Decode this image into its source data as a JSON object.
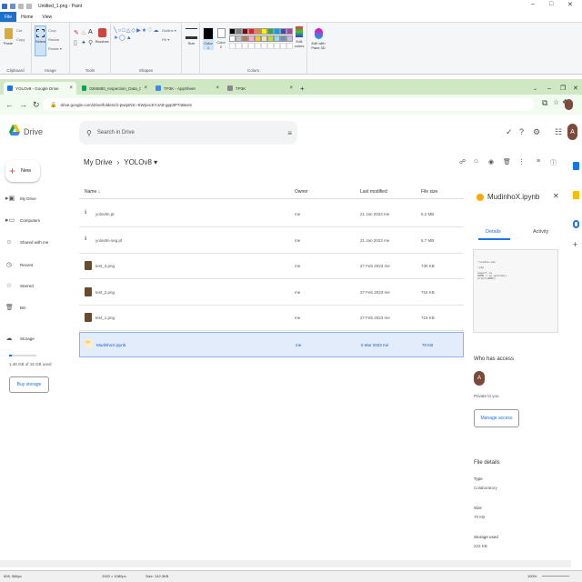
{
  "paint": {
    "title": "Untitled_1.png - Paint",
    "menu": [
      "File",
      "Home",
      "View"
    ],
    "groups": {
      "clipboard": "Clipboard",
      "image": "Image",
      "tools": "Tools",
      "shapes": "Shapes",
      "colors": "Colors"
    },
    "buttons": {
      "paste": "Paste",
      "cut": "Cut",
      "copy": "Copy",
      "select": "Select",
      "crop": "Crop",
      "resize": "Resize",
      "rotate": "Rotate ▾",
      "brushes": "Brushes",
      "outline": "Outline ▾",
      "fill": "Fill ▾",
      "size": "Size",
      "color1": "Color 1",
      "color2": "Color 2",
      "edit_colors": "Edit colors",
      "edit_paint3d": "Edit with Paint 3D"
    },
    "palette": [
      "#000000",
      "#7f7f7f",
      "#880015",
      "#ed1c24",
      "#ff7f27",
      "#fff200",
      "#22b14c",
      "#00a2e8",
      "#3f48cc",
      "#a349a4",
      "#ffffff",
      "#c3c3c3",
      "#b97a57",
      "#ffaec9",
      "#ffc90e",
      "#efe4b0",
      "#b5e61d",
      "#99d9ea",
      "#7092be",
      "#c8bfe7"
    ]
  },
  "browser": {
    "tabs": [
      {
        "label": "YOLOv8 - Google Drive",
        "color": "#1a73e8"
      },
      {
        "label": "0265880_Inspection_Data_07/03",
        "color": "#0f9d58"
      },
      {
        "label": "TP3K - AppSheet",
        "color": "#4285f4"
      },
      {
        "label": "TP3K",
        "color": "#888888"
      }
    ],
    "new_tab": "+",
    "url": "drive.google.com/drive/folders/1-pwqsNS--SWjxocKYJA8-gpp3P7nBeeS"
  },
  "drive": {
    "app": "Drive",
    "search_placeholder": "Search in Drive",
    "new": "New",
    "avatar": "A",
    "nav": [
      {
        "label": "My Drive",
        "icon": "drive"
      },
      {
        "label": "Computers",
        "icon": "computer"
      },
      {
        "label": "Shared with me",
        "icon": "people"
      },
      {
        "label": "Recent",
        "icon": "clock"
      },
      {
        "label": "Starred",
        "icon": "star"
      },
      {
        "label": "Bin",
        "icon": "trash"
      },
      {
        "label": "Storage",
        "icon": "cloud"
      }
    ],
    "storage_used": "1.48 GB of 15 GB used",
    "storage_fraction": 0.099,
    "buy_storage": "Buy storage",
    "breadcrumb": {
      "root": "My Drive",
      "sep": "›",
      "folder": "YOLOv8 ▾"
    },
    "columns": {
      "name": "Name",
      "sort": "↓",
      "owner": "Owner",
      "modified": "Last modified",
      "size": "File size"
    },
    "files": [
      {
        "name": "yolov8n.pt",
        "owner": "me",
        "modified": "21 Jan 2023 me",
        "size": "6.2 MB",
        "kind": "file"
      },
      {
        "name": "yolov8n-seg.pt",
        "owner": "me",
        "modified": "21 Jan 2023 me",
        "size": "6.7 MB",
        "kind": "file"
      },
      {
        "name": "test_3.png",
        "owner": "me",
        "modified": "27 Feb 2023 me",
        "size": "730 KB",
        "kind": "image"
      },
      {
        "name": "test_2.png",
        "owner": "me",
        "modified": "27 Feb 2023 me",
        "size": "718 KB",
        "kind": "image"
      },
      {
        "name": "test_1.png",
        "owner": "me",
        "modified": "27 Feb 2023 me",
        "size": "719 KB",
        "kind": "image"
      },
      {
        "name": "MudinhoX.ipynb",
        "owner": "me",
        "modified": "6 Mar 2023 me",
        "size": "70 KB",
        "kind": "colab"
      }
    ],
    "details": {
      "title": "MudinhoX.ipynb",
      "tab_details": "Details",
      "tab_activity": "Activity",
      "preview": "!nvidia-smi\n\n!pip\n\nimport os\nHOME = os.getcwd()\nprint(HOME)",
      "who_access": "Who has access",
      "access_avatar": "A",
      "private": "Private to you",
      "manage": "Manage access",
      "file_details": "File details",
      "type_label": "Type",
      "type_value": "Colaboratory",
      "size_label": "Size",
      "size_value": "70 KB",
      "storage_label": "Storage used",
      "storage_value": "223 KB"
    }
  },
  "status": {
    "coords": "608, 566px",
    "dims": "1920 × 1080px",
    "size": "Size: 142.3KB",
    "zoom": "100%"
  }
}
